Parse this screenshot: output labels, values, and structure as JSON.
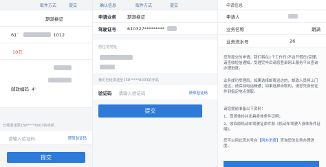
{
  "panel1": {
    "tabs": [
      "取件方式",
      "提交"
    ],
    "business_name": "期满换证",
    "cert_prefix": "61˙",
    "cert_tail": "1012",
    "fee": "10元",
    "postal_label": "邮政编码",
    "postal_tail": "4'",
    "sms_notice": "已经发送至158****8003的手机",
    "code_placeholder": "请输入验证码",
    "get_code": "获取验证码",
    "submit": "提交"
  },
  "panel2": {
    "tabs": [
      "确认信息",
      "取件方式",
      "提交"
    ],
    "applicant_type_label": "申请业务",
    "applicant_type_value": "期满换证",
    "license_label": "驾驶证号",
    "license_value": "610327*********",
    "address_label": "居住地地址",
    "sms_notice": "我们已经发送至158*****8003的手机",
    "code_label": "验证码",
    "code_placeholder": "请输入验证码",
    "get_code": "获取验证码",
    "submit": "提交"
  },
  "panel3": {
    "header": "申请信息",
    "applicant_label": "申请人",
    "business_label": "业务名称",
    "business_value": "期满",
    "serial_label": "业务流水号",
    "serial_value": "26",
    "notice1": "您所提交的申请，我们将在1个工作日(不含节假日)受理，请查收短信通知。受理完毕后请您登录网上服务平台查询办理进度。",
    "notice2": "业务成功受理后，如果选择邮寄送达的，邮政人员将上门送达，请保持电话畅通；如果选择自取的，请您凭身份证件到指定地点领取。",
    "notice3": "请您提前准备以下资料：",
    "item1": "1、现场体检并出具身体条件证明；",
    "item2": "2、收回原机动车驾驶证原件和《机动车驾驶人身体条件证明》。",
    "link_prefix": "您可以用此流水号在",
    "link_text": "【网办进度】",
    "link_suffix": "查询您的业务办理进度。"
  }
}
